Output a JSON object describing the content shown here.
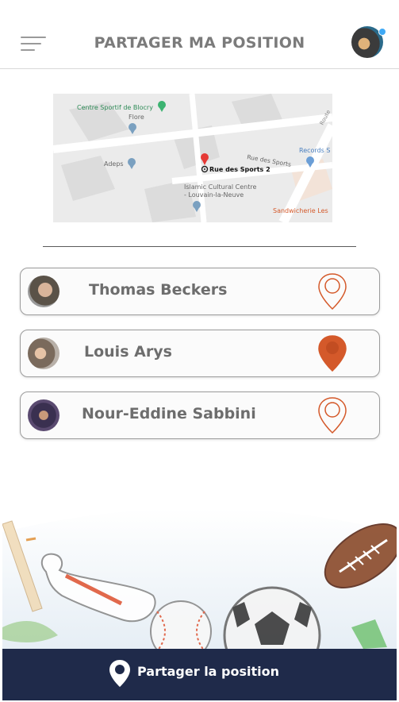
{
  "header": {
    "title": "PARTAGER MA POSITION",
    "menu_icon": "hamburger-menu-icon",
    "avatar": "user-avatar"
  },
  "map": {
    "labels": {
      "centre_sportif": "Centre Sportif de Blocry",
      "flore": "Flore",
      "adeps": "Adeps",
      "rue_des_sports_road": "Rue des Sports",
      "address": "Rue des Sports 2",
      "islamic_1": "Islamic Cultural Centre",
      "islamic_2": "- Louvain-la-Neuve",
      "records": "Records S",
      "sandwicherie": "Sandwicherie Les",
      "route": "Route"
    }
  },
  "contacts": [
    {
      "name": "Thomas Beckers",
      "sharing": false
    },
    {
      "name": "Louis Arys",
      "sharing": true
    },
    {
      "name": "Nour-Eddine Sabbini",
      "sharing": false
    }
  ],
  "colors": {
    "accent": "#d4592a",
    "footer": "#1f2a4a",
    "text": "#6d6d6d"
  },
  "footer": {
    "label": "Partager la position",
    "icon": "location-pin-icon"
  }
}
